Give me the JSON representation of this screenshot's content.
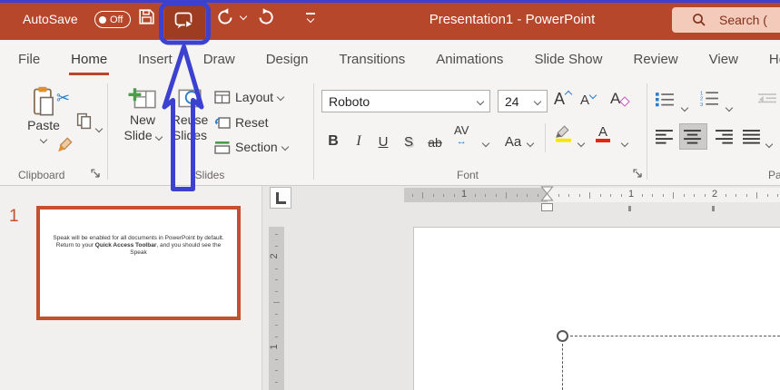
{
  "colors": {
    "titlebar_red": "#b7472a",
    "pressed_red": "#9d3c21",
    "annotation_blue": "#3c41cf",
    "search_bg": "#f4cabb",
    "highlight_yellow": "#f7e500",
    "font_color_red": "#e8240e",
    "thumb_border_red": "#c4502e"
  },
  "titlebar": {
    "autosave_label": "AutoSave",
    "autosave_state": "Off",
    "title": "Presentation1 - PowerPoint",
    "search_text": "Search ("
  },
  "tabs": {
    "items": [
      "File",
      "Home",
      "Insert",
      "Draw",
      "Design",
      "Transitions",
      "Animations",
      "Slide Show",
      "Review",
      "View",
      "Help"
    ],
    "active": "Home"
  },
  "ribbon": {
    "clipboard": {
      "label": "Clipboard",
      "paste": "Paste"
    },
    "slides": {
      "label": "Slides",
      "new_slide_line1": "New",
      "new_slide_line2": "Slide",
      "reuse_line1": "Reuse",
      "reuse_line2": "Slides",
      "layout": "Layout",
      "reset": "Reset",
      "section": "Section"
    },
    "font": {
      "label": "Font",
      "family": "Roboto",
      "size": "24",
      "grow": "A",
      "shrink": "A",
      "clear": "A",
      "bold": "B",
      "italic": "I",
      "underline": "U",
      "shadow": "S",
      "strikethrough": "ab",
      "spacing": "AV",
      "spacing_arrows": "↔",
      "case": "Aa",
      "color_letter": "A"
    },
    "paragraph": {
      "label": "Paragraph"
    }
  },
  "slides_panel": {
    "number": "1",
    "thumb": {
      "line1": "Speak will be enabled for all documents in PowerPoint by default.",
      "line2_pre": "Return to your ",
      "line2_bold": "Quick Access Toolbar",
      "line2_post": ", and you should see the",
      "line3": "Speak"
    }
  },
  "rulers": {
    "h": {
      "center": 158,
      "inch": 92,
      "from": -16,
      "to": 24,
      "length": 414
    },
    "v": {
      "center": 233,
      "inch": 100,
      "from": -19,
      "to": -4,
      "length": 181
    }
  },
  "annotation": {
    "color": "#3c41cf",
    "shape": "rectangle-around-speak-button-with-upward-arrow"
  }
}
